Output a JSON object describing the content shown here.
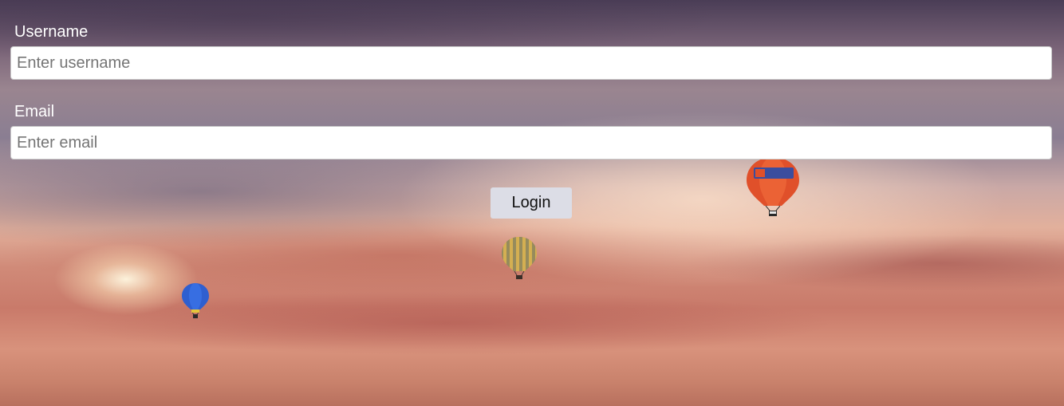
{
  "form": {
    "username": {
      "label": "Username",
      "placeholder": "Enter username"
    },
    "email": {
      "label": "Email",
      "placeholder": "Enter email"
    },
    "login_label": "Login"
  },
  "background": {
    "subject": "sunset-sky-with-hot-air-balloons",
    "balloon_colors": [
      "#2f5fd0",
      "#c9a24a",
      "#e0502a"
    ]
  }
}
